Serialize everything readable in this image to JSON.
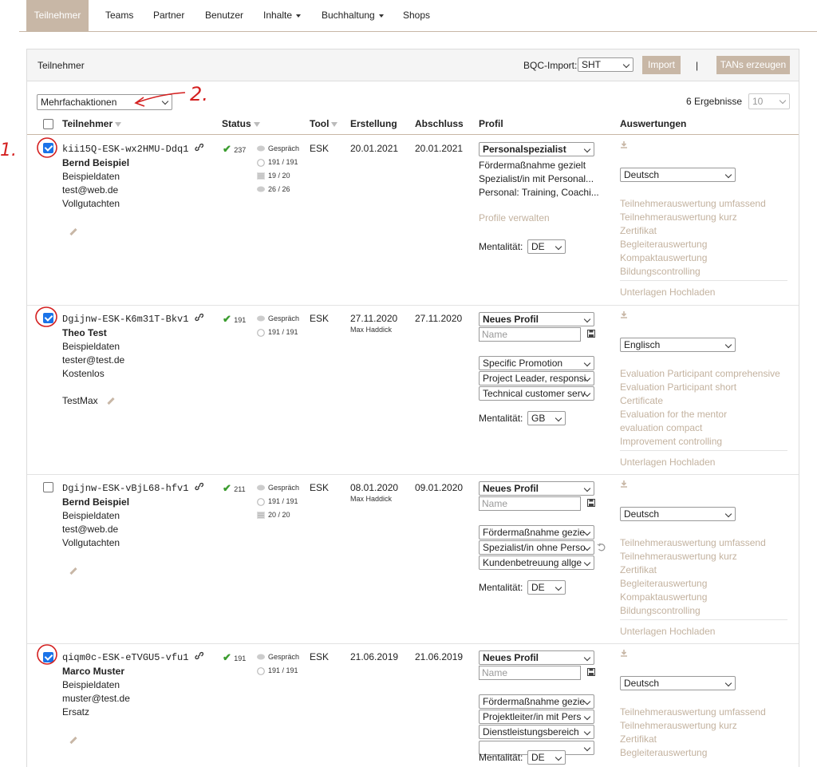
{
  "nav": {
    "items": [
      {
        "label": "Teilnehmer",
        "active": true
      },
      {
        "label": "Teams"
      },
      {
        "label": "Partner"
      },
      {
        "label": "Benutzer"
      },
      {
        "label": "Inhalte",
        "dropdown": true
      },
      {
        "label": "Buchhaltung",
        "dropdown": true
      },
      {
        "label": "Shops"
      }
    ]
  },
  "panel": {
    "title": "Teilnehmer",
    "bqc_label": "BQC-Import:",
    "bqc_value": "SHT",
    "import_label": "Import",
    "divider": "|",
    "tans_label": "TANs erzeugen"
  },
  "toolbar": {
    "bulk_actions": "Mehrfachaktionen",
    "results": "6 Ergebnisse",
    "page_size": "10"
  },
  "columns": {
    "participant": "Teilnehmer",
    "status": "Status",
    "tool": "Tool",
    "created": "Erstellung",
    "finished": "Abschluss",
    "profile": "Profil",
    "evaluations": "Auswertungen"
  },
  "annotations": {
    "one": "1.",
    "two": "2."
  },
  "common": {
    "manage_profiles": "Profile verwalten",
    "mentality_label": "Mentalität:",
    "upload": "Unterlagen Hochladen",
    "name_placeholder": "Name"
  },
  "rows": [
    {
      "checked": true,
      "code": "kii15Q-ESK-wx2HMU-Ddq1",
      "name": "Bernd Beispiel",
      "lines": [
        "Beispieldaten",
        "test@web.de",
        "Vollgutachten"
      ],
      "score": "237",
      "status": [
        {
          "icon": "chat-icon",
          "text": "Gespräch"
        },
        {
          "icon": "person-icon",
          "text": "191 / 191"
        },
        {
          "icon": "list-icon",
          "text": "19 / 20"
        },
        {
          "icon": "chat-icon",
          "text": "26 / 26"
        }
      ],
      "tool": "ESK",
      "created": "20.01.2021",
      "finished": "20.01.2021",
      "profile_select": "Personalspezialist",
      "profile_lines": [
        "Fördermaßnahme gezielt",
        "Spezialist/in mit Personal...",
        "Personal: Training, Coachi..."
      ],
      "mentality": "DE",
      "language": "Deutsch",
      "reports": [
        "Teilnehmerauswertung umfassend",
        "Teilnehmerauswertung kurz",
        "Zertifikat",
        "Begleiterauswertung",
        "Kompaktauswertung",
        "Bildungscontrolling"
      ]
    },
    {
      "checked": true,
      "code": "Dgijnw-ESK-K6m31T-Bkv1",
      "name": "Theo Test",
      "lines": [
        "Beispieldaten",
        "tester@test.de",
        "Kostenlos"
      ],
      "user": "TestMax",
      "score": "191",
      "status": [
        {
          "icon": "chat-icon",
          "text": "Gespräch"
        },
        {
          "icon": "person-icon",
          "text": "191 / 191"
        }
      ],
      "tool": "ESK",
      "created": "27.11.2020",
      "created_by": "Max Haddick",
      "finished": "27.11.2020",
      "profile_select": "Neues Profil",
      "profile_selects": [
        "Specific Promotion",
        "Project Leader, responsi",
        "Technical customer serv"
      ],
      "mentality": "GB",
      "language": "Englisch",
      "reports": [
        "Evaluation Participant comprehensive",
        "Evaluation Participant short",
        "Certificate",
        "Evaluation for the mentor",
        "evaluation compact",
        "Improvement controlling"
      ]
    },
    {
      "checked": false,
      "code": "Dgijnw-ESK-vBjL68-hfv1",
      "name": "Bernd Beispiel",
      "lines": [
        "Beispieldaten",
        "test@web.de",
        "Vollgutachten"
      ],
      "score": "211",
      "status": [
        {
          "icon": "chat-icon",
          "text": "Gespräch"
        },
        {
          "icon": "person-icon",
          "text": "191 / 191"
        },
        {
          "icon": "list-icon",
          "text": "20 / 20"
        }
      ],
      "tool": "ESK",
      "created": "08.01.2020",
      "created_by": "Max Haddick",
      "finished": "09.01.2020",
      "profile_select": "Neues Profil",
      "profile_selects": [
        "Fördermaßnahme gezie",
        "Spezialist/in ohne Perso",
        "Kundenbetreuung allge"
      ],
      "mentality": "DE",
      "language": "Deutsch",
      "reports": [
        "Teilnehmerauswertung umfassend",
        "Teilnehmerauswertung kurz",
        "Zertifikat",
        "Begleiterauswertung",
        "Kompaktauswertung",
        "Bildungscontrolling"
      ]
    },
    {
      "checked": true,
      "code": "qiqm0c-ESK-eTVGU5-vfu1",
      "name": "Marco Muster",
      "lines": [
        "Beispieldaten",
        "muster@test.de",
        "Ersatz"
      ],
      "score": "191",
      "status": [
        {
          "icon": "chat-icon",
          "text": "Gespräch"
        },
        {
          "icon": "person-icon",
          "text": "191 / 191"
        }
      ],
      "tool": "ESK",
      "created": "21.06.2019",
      "finished": "21.06.2019",
      "profile_select": "Neues Profil",
      "profile_selects": [
        "Fördermaßnahme gezie",
        "Projektleiter/in mit Pers",
        "Dienstleistungsbereich"
      ],
      "mentality": "DE",
      "language": "Deutsch",
      "reports": [
        "Teilnehmerauswertung umfassend",
        "Teilnehmerauswertung kurz",
        "Zertifikat",
        "Begleiterauswertung"
      ]
    }
  ]
}
